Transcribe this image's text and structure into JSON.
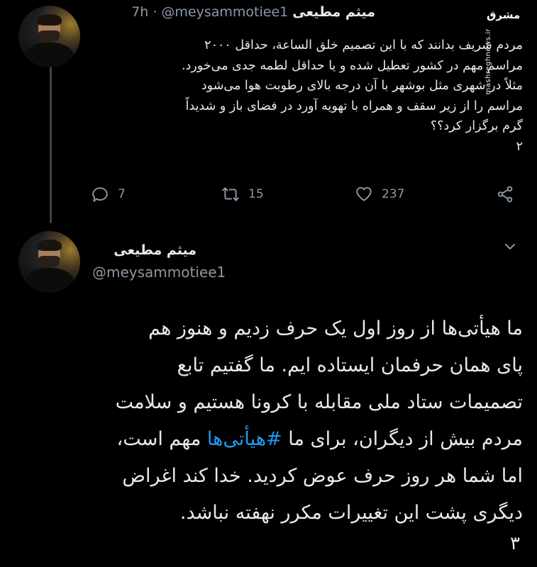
{
  "tweet1": {
    "display_name": "میثم مطیعی",
    "handle": "@meysammotiee1",
    "separator": "·",
    "time": "7h",
    "lines": [
      "مردم شریف بدانند که با این تصمیم خلق الساعة، حداقل ۲۰۰۰",
      "مراسم مهم در کشور تعطیل شده و یا حداقل لطمه جدی می‌خورد.",
      "مثلاً در شهری مثل بوشهر با آن درجه بالای رطوبت هوا می‌شود",
      "مراسم را از زیر سقف و همراه با تهویه آورد در فضای باز و شدیداً",
      "گرم برگزار کرد؟؟",
      "۲"
    ],
    "actions": {
      "reply_count": "7",
      "retweet_count": "15",
      "like_count": "237"
    }
  },
  "tweet2": {
    "display_name": "میثم مطیعی",
    "handle": "@meysammotiee1",
    "lines": [
      "ما هیأتی‌ها از روز اول یک حرف زدیم و هنوز هم",
      "پای همان حرفمان ایستاده ایم. ما گفتیم تابع",
      "تصمیمات ستاد ملی مقابله با کرونا هستیم و سلامت"
    ],
    "line4_before": "مردم بیش از دیگران، برای ما ",
    "hashtag": "#هیأتی‌ها",
    "line4_after": " مهم است،",
    "lines_after": [
      "اما شما هر روز حرف عوض کردید. خدا کند اغراض",
      "دیگری پشت این تغییرات مکرر نهفته نباشد."
    ],
    "number": "۳"
  },
  "watermark": {
    "logo": "مشرق",
    "site": "mashreghnews.ir"
  },
  "colors": {
    "background": "#000000",
    "text": "#e7e9ea",
    "secondary": "#8b98a5",
    "hashtag": "#1d9bf0"
  }
}
